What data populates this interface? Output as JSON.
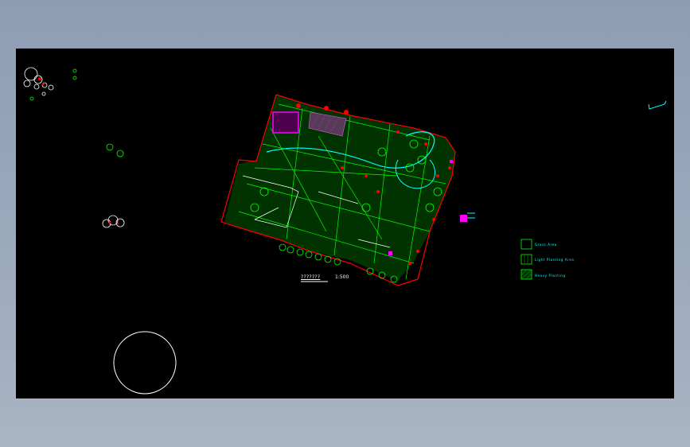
{
  "drawing": {
    "scale_text": "??????? ",
    "scale_ratio": "1:500"
  },
  "legend": {
    "items": [
      {
        "label": "Grass Area"
      },
      {
        "label": "Light Planting Area"
      },
      {
        "label": "Heavy Planting"
      }
    ]
  },
  "colors": {
    "background": "#000000",
    "boundary": "#ff0000",
    "planting": "#00ff00",
    "path": "#00ffff",
    "highlight": "#ff00ff",
    "outline": "#ffffff"
  }
}
